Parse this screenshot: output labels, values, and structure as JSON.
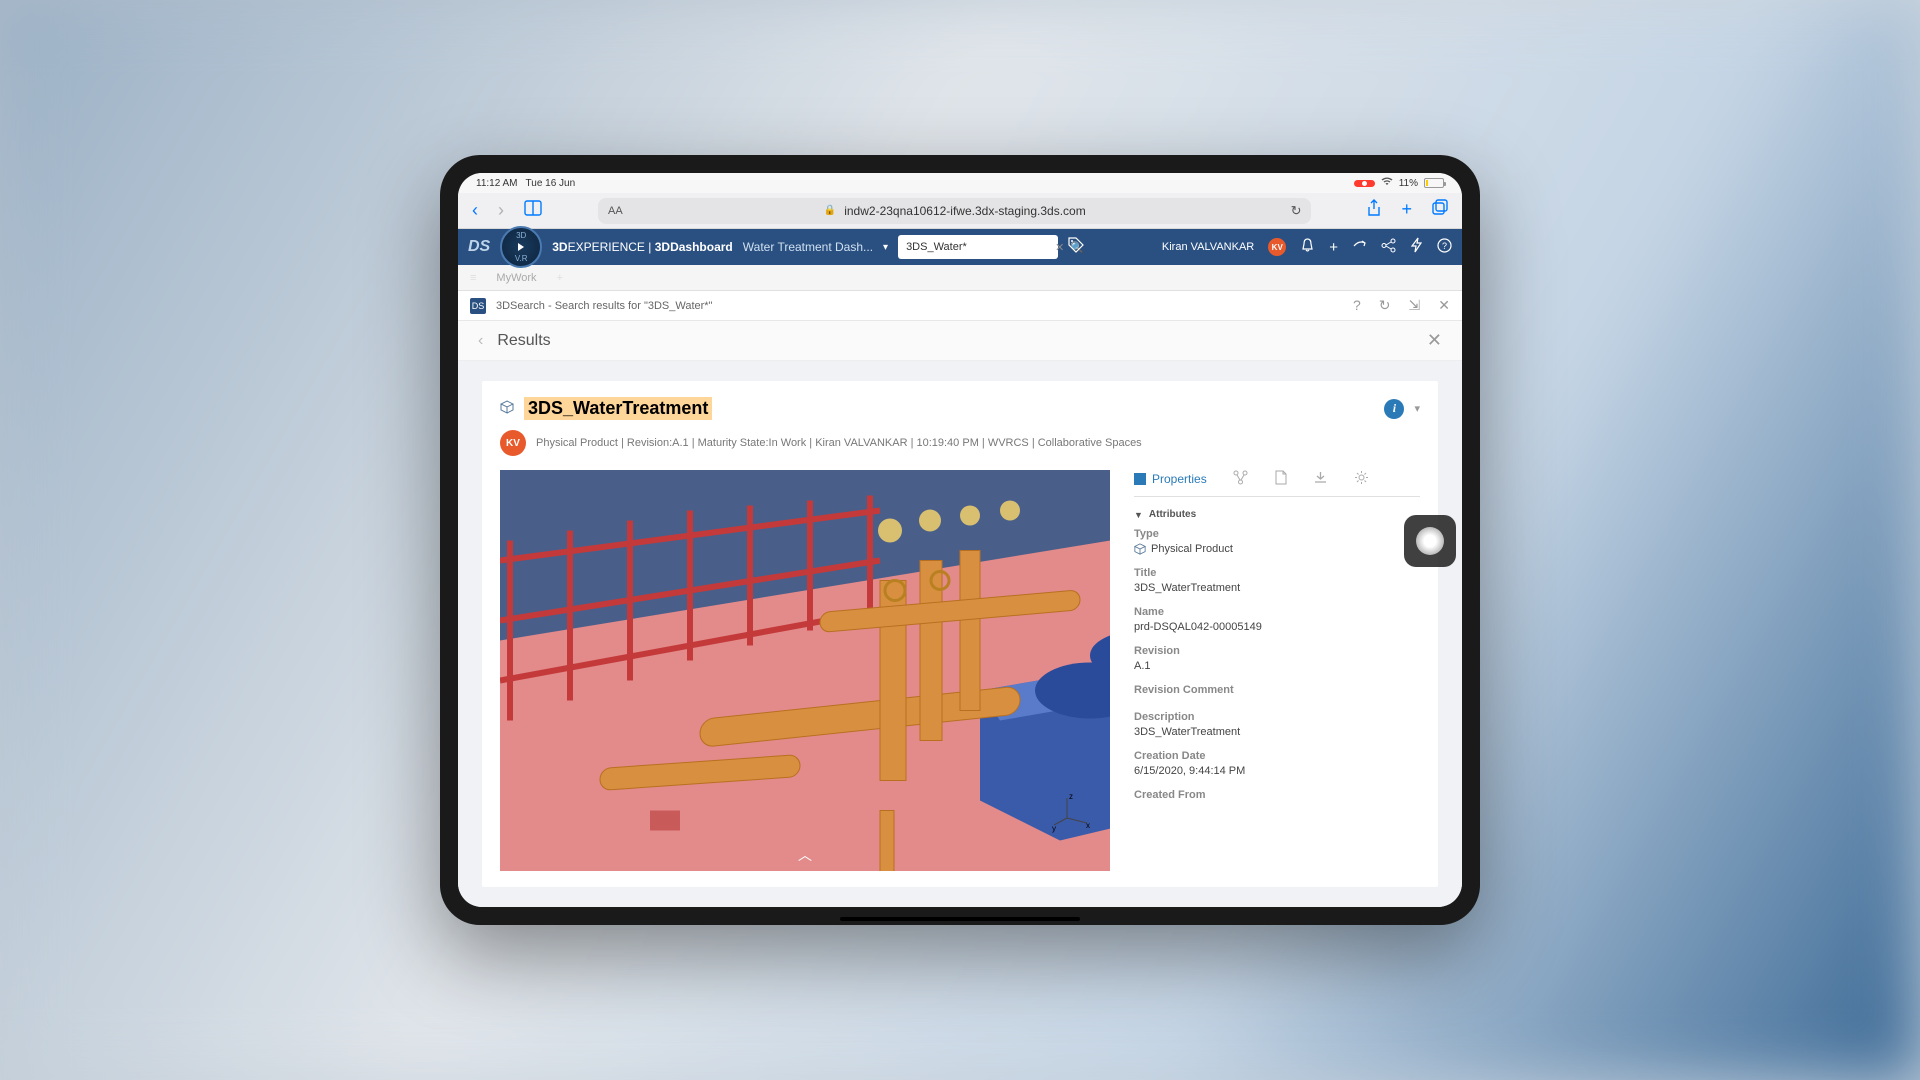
{
  "ios": {
    "time": "11:12 AM",
    "date": "Tue 16 Jun",
    "battery": "11%"
  },
  "safari": {
    "url": "indw2-23qna10612-ifwe.3dx-staging.3ds.com"
  },
  "app": {
    "brand1": "3D",
    "brand2": "EXPERIENCE",
    "brand3": "3DDashboard",
    "dash_name": "Water Treatment Dash...",
    "search_value": "3DS_Water*",
    "user_name": "Kiran VALVANKAR",
    "user_initials": "KV"
  },
  "secbar": {
    "mywork": "MyWork"
  },
  "searchhdr": {
    "title": "3DSearch - Search results for \"3DS_Water*\""
  },
  "results": {
    "title": "Results"
  },
  "card": {
    "title": "3DS_WaterTreatment",
    "meta": "Physical Product | Revision:A.1 | Maturity State:In Work | Kiran VALVANKAR | 10:19:40 PM | WVRCS | Collaborative Spaces",
    "av": "KV"
  },
  "tabs": {
    "properties": "Properties"
  },
  "attrs": {
    "header": "Attributes",
    "type_label": "Type",
    "type_value": "Physical Product",
    "title_label": "Title",
    "title_value": "3DS_WaterTreatment",
    "name_label": "Name",
    "name_value": "prd-DSQAL042-00005149",
    "revision_label": "Revision",
    "revision_value": "A.1",
    "revcomment_label": "Revision Comment",
    "revcomment_value": "",
    "desc_label": "Description",
    "desc_value": "3DS_WaterTreatment",
    "cdate_label": "Creation Date",
    "cdate_value": "6/15/2020, 9:44:14 PM",
    "cfrom_label": "Created From"
  },
  "axis": {
    "x": "x",
    "y": "y",
    "z": "z"
  }
}
